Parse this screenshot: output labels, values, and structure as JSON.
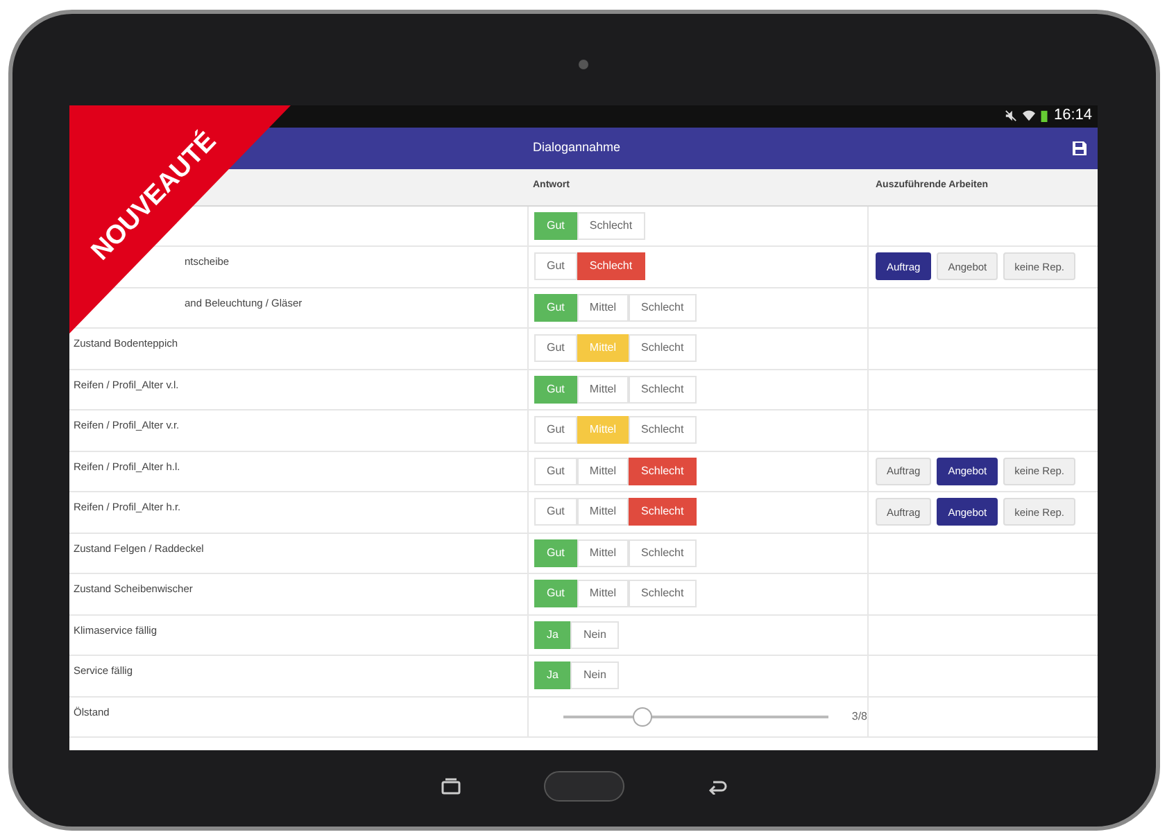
{
  "ribbon": {
    "text": "NOUVEAUTÉ"
  },
  "status_bar": {
    "time": "16:14"
  },
  "app_bar": {
    "title": "Dialogannahme"
  },
  "table": {
    "columns": [
      "Antwort",
      "Auszuführende Arbeiten"
    ],
    "rows": [
      {
        "kind": "choice",
        "label": "",
        "options": [
          {
            "label": "Gut",
            "selected": true
          },
          {
            "label": "Schlecht",
            "selected": false
          }
        ],
        "work": []
      },
      {
        "kind": "choice",
        "label": "ntscheibe",
        "options": [
          {
            "label": "Gut",
            "selected": false
          },
          {
            "label": "Schlecht",
            "selected": true
          }
        ],
        "work": [
          {
            "label": "Auftrag",
            "selected": true
          },
          {
            "label": "Angebot",
            "selected": false
          },
          {
            "label": "keine Rep.",
            "selected": false
          }
        ]
      },
      {
        "kind": "choice",
        "label": "and Beleuchtung / Gläser",
        "options": [
          {
            "label": "Gut",
            "selected": true
          },
          {
            "label": "Mittel",
            "selected": false
          },
          {
            "label": "Schlecht",
            "selected": false
          }
        ],
        "work": []
      },
      {
        "kind": "choice",
        "label": "Zustand Bodenteppich",
        "options": [
          {
            "label": "Gut",
            "selected": false
          },
          {
            "label": "Mittel",
            "selected": true
          },
          {
            "label": "Schlecht",
            "selected": false
          }
        ],
        "work": []
      },
      {
        "kind": "choice",
        "label": "Reifen / Profil_Alter v.l.",
        "options": [
          {
            "label": "Gut",
            "selected": true
          },
          {
            "label": "Mittel",
            "selected": false
          },
          {
            "label": "Schlecht",
            "selected": false
          }
        ],
        "work": []
      },
      {
        "kind": "choice",
        "label": "Reifen / Profil_Alter v.r.",
        "options": [
          {
            "label": "Gut",
            "selected": false
          },
          {
            "label": "Mittel",
            "selected": true
          },
          {
            "label": "Schlecht",
            "selected": false
          }
        ],
        "work": []
      },
      {
        "kind": "choice",
        "label": "Reifen / Profil_Alter h.l.",
        "options": [
          {
            "label": "Gut",
            "selected": false
          },
          {
            "label": "Mittel",
            "selected": false
          },
          {
            "label": "Schlecht",
            "selected": true
          }
        ],
        "work": [
          {
            "label": "Auftrag",
            "selected": false
          },
          {
            "label": "Angebot",
            "selected": true
          },
          {
            "label": "keine Rep.",
            "selected": false
          }
        ]
      },
      {
        "kind": "choice",
        "label": "Reifen / Profil_Alter h.r.",
        "options": [
          {
            "label": "Gut",
            "selected": false
          },
          {
            "label": "Mittel",
            "selected": false
          },
          {
            "label": "Schlecht",
            "selected": true
          }
        ],
        "work": [
          {
            "label": "Auftrag",
            "selected": false
          },
          {
            "label": "Angebot",
            "selected": true
          },
          {
            "label": "keine Rep.",
            "selected": false
          }
        ]
      },
      {
        "kind": "choice",
        "label": "Zustand Felgen / Raddeckel",
        "options": [
          {
            "label": "Gut",
            "selected": true
          },
          {
            "label": "Mittel",
            "selected": false
          },
          {
            "label": "Schlecht",
            "selected": false
          }
        ],
        "work": []
      },
      {
        "kind": "choice",
        "label": "Zustand Scheibenwischer",
        "options": [
          {
            "label": "Gut",
            "selected": true
          },
          {
            "label": "Mittel",
            "selected": false
          },
          {
            "label": "Schlecht",
            "selected": false
          }
        ],
        "work": []
      },
      {
        "kind": "choice",
        "label": "Klimaservice fällig",
        "options": [
          {
            "label": "Ja",
            "selected": true
          },
          {
            "label": "Nein",
            "selected": false
          }
        ],
        "work": []
      },
      {
        "kind": "choice",
        "label": "Service fällig",
        "options": [
          {
            "label": "Ja",
            "selected": true
          },
          {
            "label": "Nein",
            "selected": false
          }
        ],
        "work": []
      },
      {
        "kind": "slider",
        "label": "Ölstand",
        "level": 0.3,
        "reading": "3/8",
        "work": []
      }
    ]
  }
}
